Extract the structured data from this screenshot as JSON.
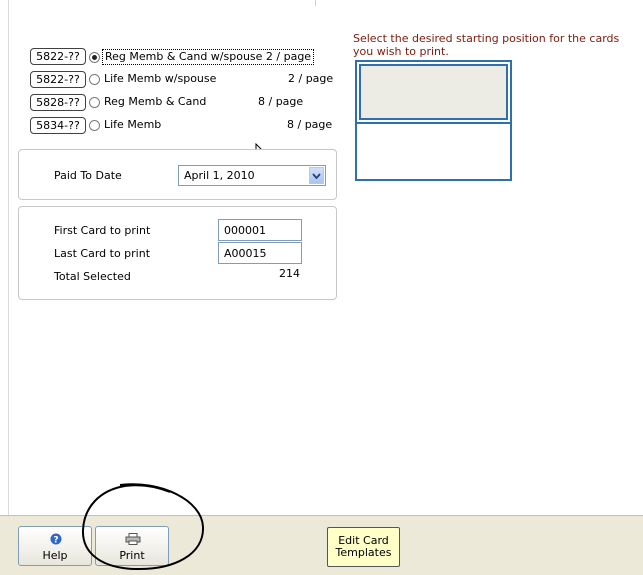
{
  "card_options": [
    {
      "code": "5822-??",
      "label": "Reg Memb & Cand  w/spouse  2 / page",
      "per_page": "",
      "selected": true
    },
    {
      "code": "5822-??",
      "label": "Life Memb w/spouse",
      "per_page": "2 / page",
      "selected": false
    },
    {
      "code": "5828-??",
      "label": "Reg Memb & Cand",
      "per_page": "8 / page",
      "selected": false
    },
    {
      "code": "5834-??",
      "label": "Life Memb",
      "per_page": "8 / page",
      "selected": false
    }
  ],
  "paid_to_date": {
    "label": "Paid To Date",
    "value": "April 1, 2010"
  },
  "range": {
    "first_label": "First Card to print",
    "first_value": "000001",
    "last_label": "Last Card to print",
    "last_value": "A00015",
    "total_label": "Total Selected",
    "total_value": "214"
  },
  "position_panel": {
    "instruction": "Select the desired starting position for the cards you wish to print."
  },
  "footer": {
    "help_label": "Help",
    "print_label": "Print",
    "edit_templates_line1": "Edit Card",
    "edit_templates_line2": "Templates"
  },
  "colors": {
    "instruction_text": "#7a1c0d",
    "grid_border": "#2f6fb0",
    "footer_bg": "#ece9d8",
    "edit_button_bg": "#ffffc8"
  }
}
